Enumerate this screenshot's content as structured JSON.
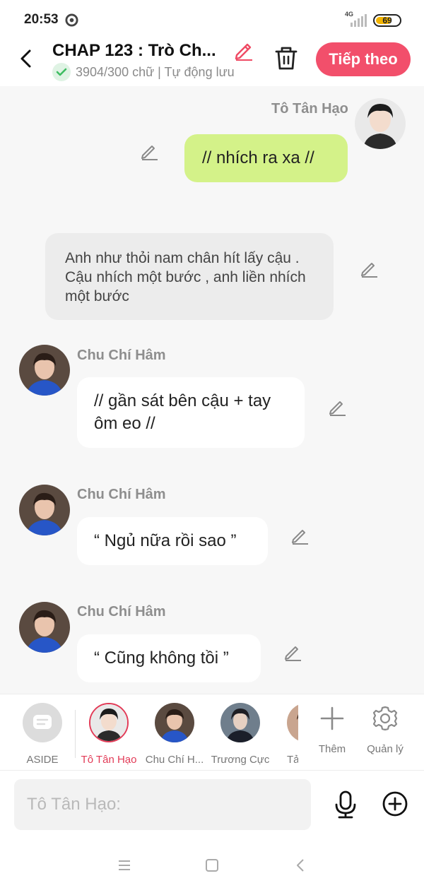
{
  "status": {
    "time": "20:53",
    "network": "4G",
    "battery": "69",
    "battery_level": 0.69
  },
  "header": {
    "title": "CHAP 123 : Trò Ch...",
    "word_count": "3904/300 chữ | Tự động lưu",
    "next_label": "Tiếp theo"
  },
  "messages": [
    {
      "speaker": "Tô Tân Hạo",
      "text": "// nhích ra xa //",
      "side": "right",
      "style": "green"
    },
    {
      "speaker": "",
      "text": "Anh như thỏi nam chân hít lấy cậu . Cậu nhích một bước , anh liền nhích một bước",
      "side": "center",
      "style": "aside"
    },
    {
      "speaker": "Chu Chí Hâm",
      "text": "// gần sát bên cậu + tay ôm eo //",
      "side": "left",
      "style": "white"
    },
    {
      "speaker": "Chu Chí Hâm",
      "text": "“ Ngủ nữa rồi sao ”",
      "side": "left",
      "style": "white"
    },
    {
      "speaker": "Chu Chí Hâm",
      "text": "“ Cũng không tồi ”",
      "side": "left",
      "style": "white"
    }
  ],
  "characters": [
    {
      "label": "ASIDE",
      "icon": "chat-bubble-icon",
      "active": false
    },
    {
      "label": "Tô Tân Hạo",
      "icon": "avatar",
      "active": true
    },
    {
      "label": "Chu Chí H...",
      "icon": "avatar",
      "active": false
    },
    {
      "label": "Trương Cực",
      "icon": "avatar",
      "active": false
    },
    {
      "label": "Tả",
      "icon": "avatar",
      "active": false
    }
  ],
  "tools": {
    "add_label": "Thêm",
    "manage_label": "Quản lý"
  },
  "input": {
    "placeholder": "Tô Tân Hạo:"
  },
  "colors": {
    "accent": "#f24f6b",
    "green_bubble": "#d4f289",
    "active_char": "#e23b57"
  }
}
